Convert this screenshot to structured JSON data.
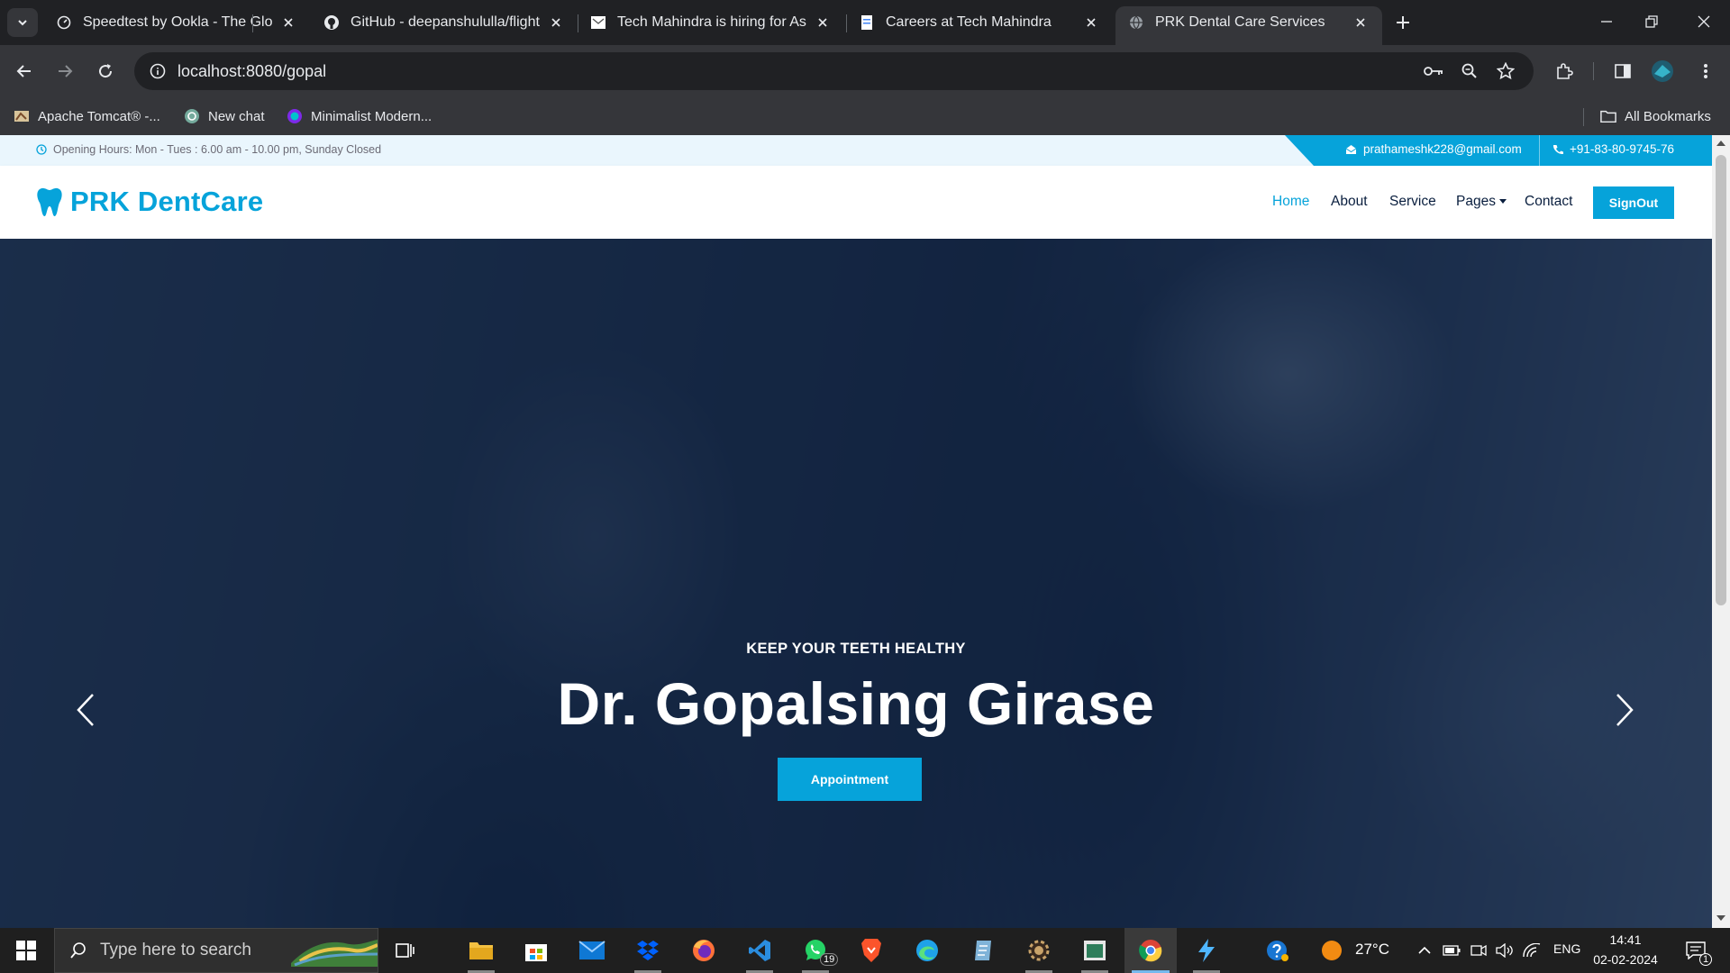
{
  "browser": {
    "tabs": [
      {
        "title": "Speedtest by Ookla - The Global",
        "icon": "speedtest-icon",
        "active": false
      },
      {
        "title": "GitHub - deepanshululla/flight-",
        "icon": "github-icon",
        "active": false
      },
      {
        "title": "Tech Mahindra is hiring for Asso",
        "icon": "gmail-icon",
        "active": false
      },
      {
        "title": "Careers at Tech Mahindra",
        "icon": "document-icon",
        "active": false
      },
      {
        "title": "PRK Dental Care Services",
        "icon": "globe-icon",
        "active": true
      }
    ],
    "url": "localhost:8080/gopal",
    "bookmarks": [
      {
        "label": "Apache Tomcat® -...",
        "icon": "tomcat-icon"
      },
      {
        "label": "New chat",
        "icon": "chatgpt-icon"
      },
      {
        "label": "Minimalist Modern...",
        "icon": "canva-icon"
      }
    ],
    "all_bookmarks": "All Bookmarks"
  },
  "site": {
    "topbar": {
      "hours": "Opening Hours: Mon - Tues : 6.00 am - 10.00 pm, Sunday Closed",
      "email": "prathameshk228@gmail.com",
      "phone": "+91-83-80-9745-76"
    },
    "brand": "PRK DentCare",
    "nav": {
      "home": "Home",
      "about": "About",
      "service": "Service",
      "pages": "Pages",
      "contact": "Contact",
      "signout": "SignOut"
    },
    "hero": {
      "subtitle": "KEEP YOUR TEETH HEALTHY",
      "title": "Dr. Gopalsing Girase",
      "button": "Appointment"
    },
    "colors": {
      "primary": "#06a3da",
      "dark": "#091e3e",
      "topbar_bg": "#eaf6fd"
    }
  },
  "taskbar": {
    "search_placeholder": "Type here to search",
    "whatsapp_badge": "19",
    "temperature": "27°C",
    "language": "ENG",
    "time": "14:41",
    "date": "02-02-2024",
    "notification_count": "1"
  }
}
